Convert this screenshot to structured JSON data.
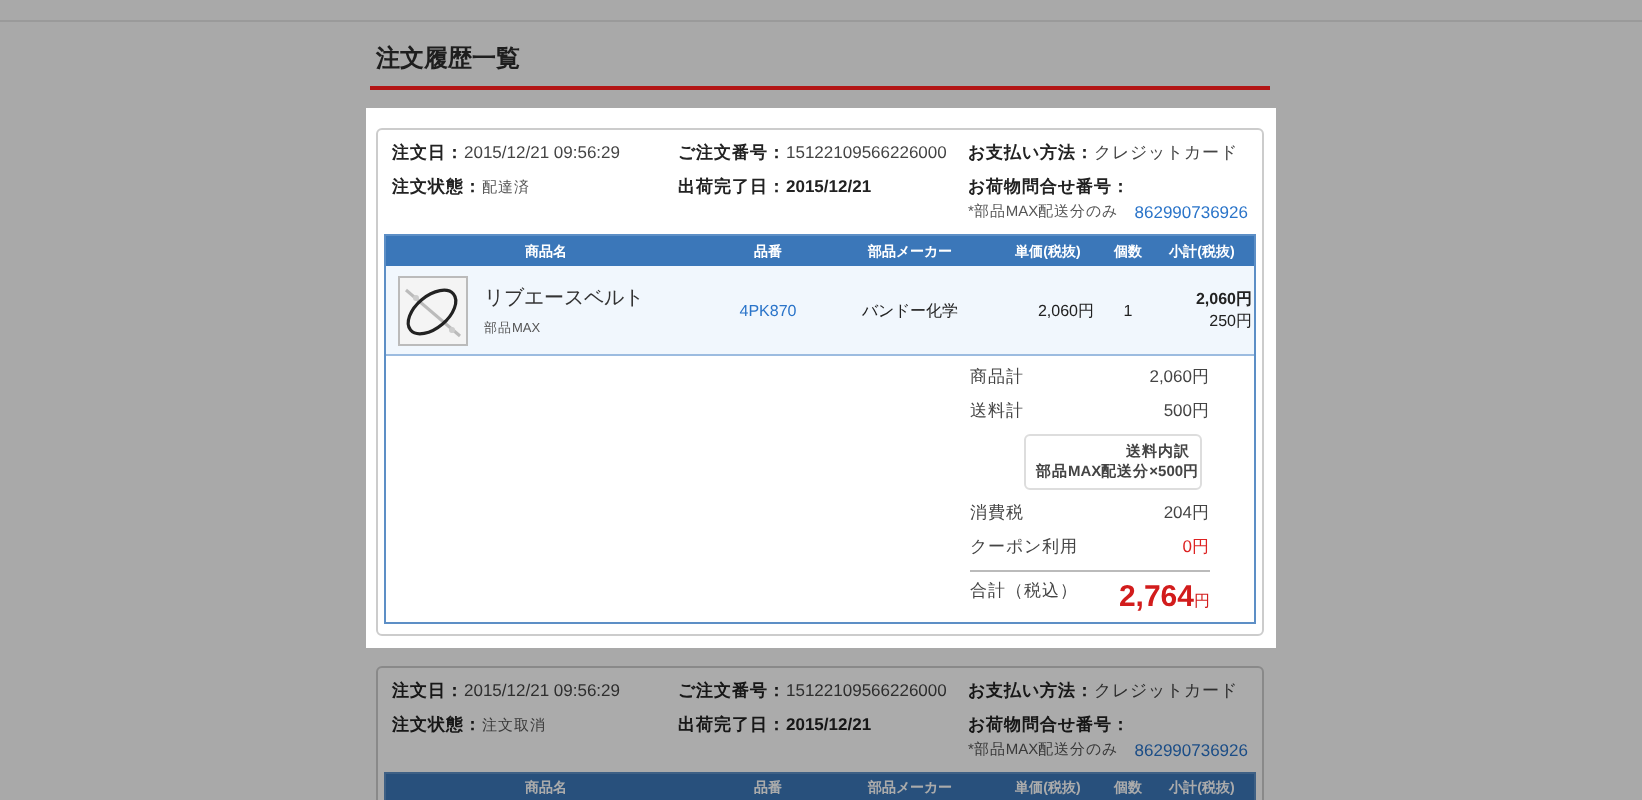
{
  "page_title": "注文履歴一覧",
  "orders": [
    {
      "highlighted": true,
      "info": [
        {
          "label": "注文日：",
          "value": "2015/12/21 09:56:29",
          "kind": "plain"
        },
        {
          "label": "ご注文番号：",
          "value": "15122109566226000",
          "kind": "plain"
        },
        {
          "label": "お支払い方法：",
          "value": "クレジットカード",
          "kind": "plain"
        },
        {
          "label": "注文状態：",
          "value": "配達済",
          "kind": "small"
        },
        {
          "label": "出荷完了日：",
          "value": "2015/12/21",
          "kind": "bold"
        },
        {
          "label": "お荷物問合せ番号：",
          "note": "*部品MAX配送分のみ",
          "value": "862990736926",
          "kind": "tracking"
        }
      ],
      "columns": [
        "商品名",
        "品番",
        "部品メーカー",
        "単価(税抜)",
        "個数",
        "小計(税抜)"
      ],
      "items": [
        {
          "kind": "picture",
          "name": "リブエースベルト",
          "shop": "部品MAX",
          "part_no": "4PK870",
          "maker": "バンドー化学",
          "price": "2,060円",
          "qty": "1",
          "subtotal": "2,060円",
          "shipping": "250円"
        }
      ],
      "summary": {
        "rows": [
          {
            "label": "商品計",
            "value": "2,060円",
            "kind": "plain"
          },
          {
            "label": "送料計",
            "value": "500円",
            "kind": "plain"
          },
          {
            "label": "送料内訳",
            "value": "部品MAX配送分×500円",
            "kind": "box"
          },
          {
            "label": "消費税",
            "value": "204円",
            "kind": "plain"
          },
          {
            "label": "クーポン利用",
            "value": "0円",
            "kind": "red"
          }
        ],
        "total_label": "合計（税込）",
        "total": "2,764",
        "total_unit": "円"
      }
    },
    {
      "highlighted": false,
      "info": [
        {
          "label": "注文日：",
          "value": "2015/12/21 09:56:29",
          "kind": "plain"
        },
        {
          "label": "ご注文番号：",
          "value": "15122109566226000",
          "kind": "plain"
        },
        {
          "label": "お支払い方法：",
          "value": "クレジットカード",
          "kind": "plain"
        },
        {
          "label": "注文状態：",
          "value": "注文取消",
          "kind": "small"
        },
        {
          "label": "出荷完了日：",
          "value": "2015/12/21",
          "kind": "bold"
        },
        {
          "label": "お荷物問合せ番号：",
          "note": "*部品MAX配送分のみ",
          "value": "862990736926",
          "kind": "tracking"
        }
      ],
      "columns": [
        "商品名",
        "品番",
        "部品メーカー",
        "単価(税抜)",
        "個数",
        "小計(税抜)"
      ]
    }
  ]
}
